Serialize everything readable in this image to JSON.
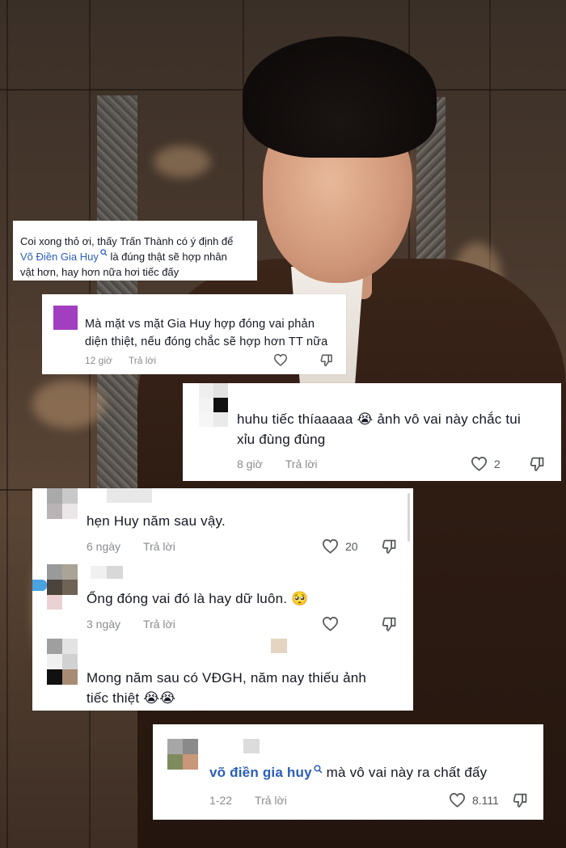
{
  "caption": {
    "line1": "Coi xong thỏ ơi, thấy Trấn Thành có ý định để",
    "mention": "Võ Điền Gia Huy",
    "line2_rest": " là đúng thật sẽ hợp nhân",
    "line3": "vật hơn, hay hơn nữa hơi tiếc đấy"
  },
  "comments": [
    {
      "line1": "Mà mặt vs mặt Gia Huy hợp đóng vai phản",
      "line2": "diện thiệt, nếu đóng chắc sẽ hợp hơn TT nữa",
      "time": "12 giờ",
      "reply": "Trả lời",
      "likes": "",
      "avatar_color": "#a23fc0"
    },
    {
      "line1": "huhu tiếc thíaaaaa 😭 ảnh vô vai này chắc tui",
      "line2": "xỉu đùng đùng",
      "time": "8 giờ",
      "reply": "Trả lời",
      "likes": "2"
    },
    {
      "line1": "hẹn Huy năm sau vậy.",
      "time": "6 ngày",
      "reply": "Trả lời",
      "likes": "20"
    },
    {
      "line1": "Ổng đóng vai đó là hay dữ luôn. 🥺",
      "time": "3 ngày",
      "reply": "Trả lời",
      "likes": ""
    },
    {
      "line1": "Mong năm sau có VĐGH, năm nay thiếu ảnh",
      "line2": "tiếc thiệt 😭😭"
    },
    {
      "mention": "võ điền gia huy",
      "rest": " mà vô vai này ra chất đấy",
      "time": "1-22",
      "reply": "Trả lời",
      "likes": "8.111"
    }
  ],
  "icons": {
    "heart": "heart-icon",
    "dislike": "dislike-icon",
    "search": "search-icon"
  },
  "colors": {
    "text": "#161823",
    "meta": "#8a8b91",
    "mention": "#2b5db8"
  }
}
